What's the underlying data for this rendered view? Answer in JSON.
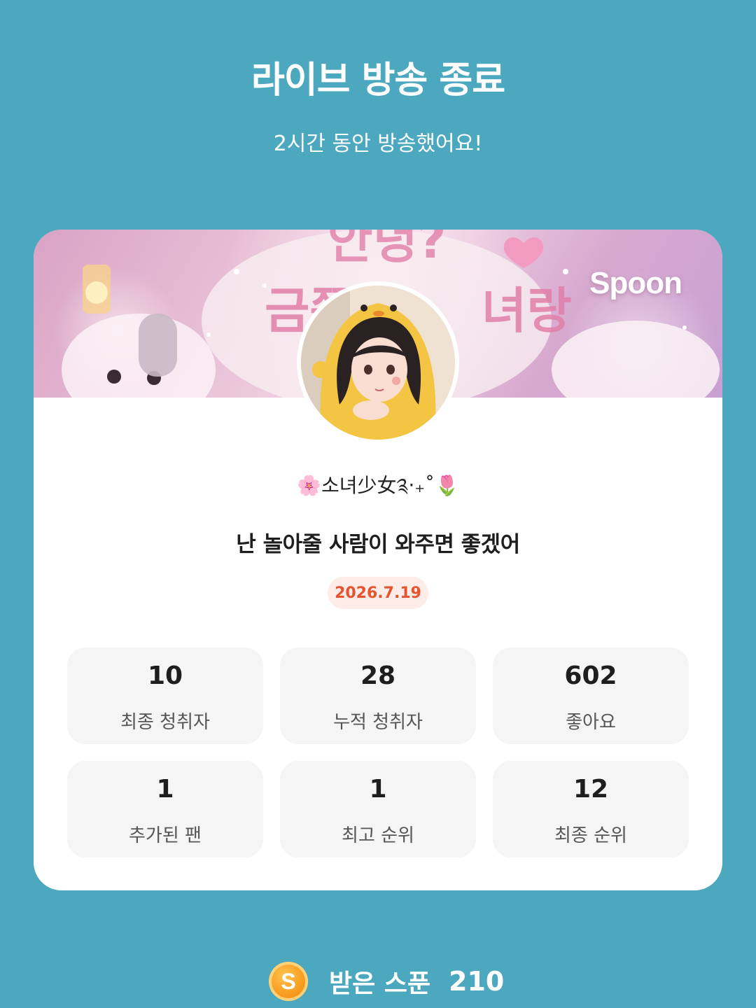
{
  "header": {
    "title": "라이브 방송 종료",
    "subtitle": "2시간 동안 방송했어요!"
  },
  "banner": {
    "logo_text": "Spoon"
  },
  "profile": {
    "nickname": "🌸소녀少女༉‧₊˚🌷"
  },
  "broadcast": {
    "title": "난 놀아줄 사람이 와주면 좋겠어",
    "date": "2026.7.19"
  },
  "stats": [
    {
      "value": "10",
      "label": "최종 청취자"
    },
    {
      "value": "28",
      "label": "누적 청취자"
    },
    {
      "value": "602",
      "label": "좋아요"
    },
    {
      "value": "1",
      "label": "추가된 팬"
    },
    {
      "value": "1",
      "label": "최고 순위"
    },
    {
      "value": "12",
      "label": "최종 순위"
    }
  ],
  "received": {
    "coin_letter": "S",
    "label": "받은 스푼",
    "value": "210"
  },
  "colors": {
    "background": "#4ba8bf",
    "accent_date": "#e5532f",
    "coin": "#f79a1c"
  }
}
